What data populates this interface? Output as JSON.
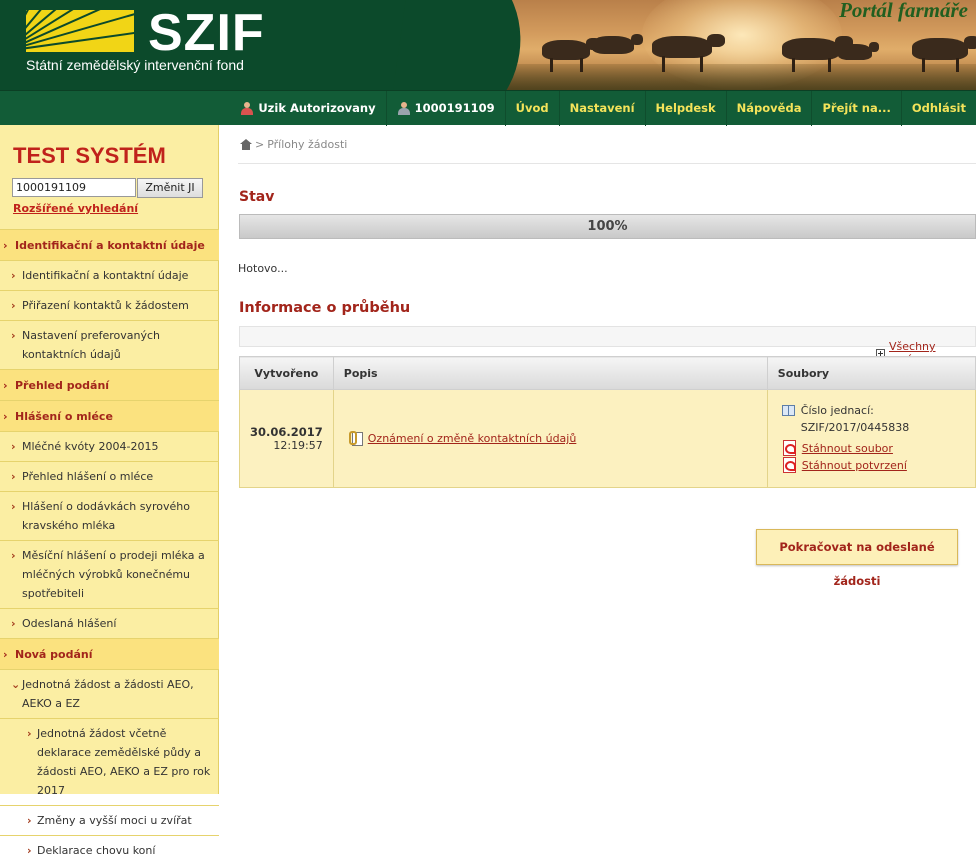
{
  "header": {
    "logo_text": "SZIF",
    "logo_subtitle": "Státní zemědělský intervenční fond",
    "portal_title": "Portál farmáře"
  },
  "topnav": {
    "user_name": "Uzik Autorizovany",
    "user_id": "1000191109",
    "items": [
      "Úvod",
      "Nastavení",
      "Helpdesk",
      "Nápověda",
      "Přejít na...",
      "Odhlásit"
    ]
  },
  "sidebar": {
    "title": "TEST SYSTÉM",
    "ji_value": "1000191109",
    "ji_button": "Změnit JI",
    "advanced_search": "Rozšířené vyhledání",
    "menu": [
      {
        "label": "Identifikační a kontaktní údaje",
        "type": "section"
      },
      {
        "label": "Identifikační a kontaktní údaje",
        "type": "item"
      },
      {
        "label": "Přiřazení kontaktů k žádostem",
        "type": "item"
      },
      {
        "label": "Nastavení preferovaných kontaktních údajů",
        "type": "item"
      },
      {
        "label": "Přehled podání",
        "type": "section"
      },
      {
        "label": "Hlášení o mléce",
        "type": "section"
      },
      {
        "label": "Mléčné kvóty 2004-2015",
        "type": "item"
      },
      {
        "label": "Přehled hlášení o mléce",
        "type": "item"
      },
      {
        "label": "Hlášení o dodávkách syrového kravského mléka",
        "type": "item"
      },
      {
        "label": "Měsíční hlášení o prodeji mléka a mléčných výrobků konečnému spotřebiteli",
        "type": "item"
      },
      {
        "label": "Odeslaná hlášení",
        "type": "item"
      },
      {
        "label": "Nová podání",
        "type": "section"
      },
      {
        "label": "Jednotná žádost a žádosti AEO, AEKO a EZ",
        "type": "item-open"
      },
      {
        "label": "Jednotná žádost včetně deklarace zemědělské půdy a žádosti AEO, AEKO a EZ pro rok 2017",
        "type": "sub2"
      },
      {
        "label": "Změny a vyšší moci u zvířat",
        "type": "sub2"
      },
      {
        "label": "Deklarace chovu koní",
        "type": "sub2"
      }
    ]
  },
  "breadcrumb": {
    "separator": ">",
    "current": "Přílohy žádosti"
  },
  "status": {
    "heading": "Stav",
    "progress_text": "100%",
    "progress_value": 100,
    "done_text": "Hotovo..."
  },
  "info": {
    "heading": "Informace o průběhu",
    "all_messages": "Všechny zprávy",
    "columns": [
      "Vytvořeno",
      "Popis",
      "Soubory"
    ],
    "rows": [
      {
        "date": "30.06.2017",
        "time": "12:19:57",
        "description": "Oznámení o změně kontaktních údajů",
        "ref_label": "Číslo jednací:",
        "ref_value": "SZIF/2017/0445838",
        "download_file": "Stáhnout soubor",
        "download_confirm": "Stáhnout potvrzení"
      }
    ]
  },
  "continue_button": "Pokračovat na odeslané žádosti"
}
